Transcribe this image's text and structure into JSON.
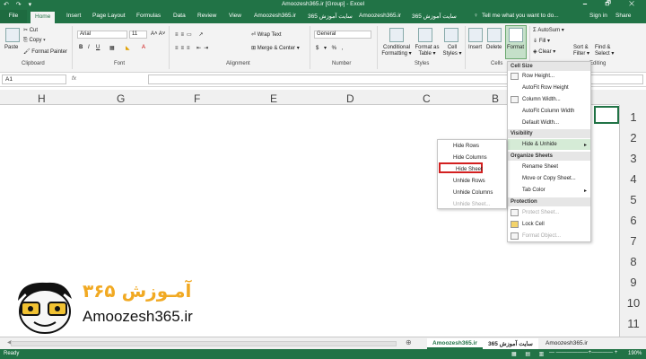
{
  "window": {
    "title": "Amoozesh365.ir  [Group]  - Excel",
    "qat": "↶ ↷ ▾",
    "controls": "🗕 🗗 ✕"
  },
  "tabs": {
    "file": "File",
    "home": "Home",
    "insert": "Insert",
    "page_layout": "Page Layout",
    "formulas": "Formulas",
    "data": "Data",
    "review": "Review",
    "view": "View",
    "extra1": "Amoozesh365.ir",
    "extra2": "سایت آموزش 365",
    "extra3": "Amoozesh365.ir",
    "extra4": "سایت آموزش 365",
    "tell_me": "Tell me what you want to do...",
    "signin": "Sign in",
    "share": "Share"
  },
  "ribbon": {
    "paste": "Paste",
    "cut": "Cut",
    "copy": "Copy ▾",
    "format_painter": "Format Painter",
    "clipboard": "Clipboard",
    "font_name": "Arial",
    "font_size": "11",
    "font_group": "Font",
    "wrap_text": "Wrap Text",
    "merge_center": "Merge & Center ▾",
    "alignment": "Alignment",
    "number_format": "General",
    "number_group": "Number",
    "number_symbols": "$ ▾ % ,",
    "cond_format": "Conditional Formatting ▾",
    "format_table": "Format as Table ▾",
    "cell_styles": "Cell Styles ▾",
    "styles": "Styles",
    "insert": "Insert",
    "delete": "Delete",
    "format": "Format",
    "cells": "Cells",
    "autosum": "AutoSum ▾",
    "fill": "Fill ▾",
    "clear": "Clear ▾",
    "sort_filter": "Sort & Filter ▾",
    "find_select": "Find & Select ▾",
    "editing": "Editing"
  },
  "formula_bar": {
    "name_box": "A1",
    "fx": "fx",
    "value": ""
  },
  "columns": [
    "H",
    "G",
    "F",
    "E",
    "D",
    "C",
    "B"
  ],
  "rows": [
    "1",
    "2",
    "3",
    "4",
    "5",
    "6",
    "7",
    "8",
    "9",
    "10",
    "11"
  ],
  "format_menu": {
    "cell_size": "Cell Size",
    "row_height": "Row Height...",
    "autofit_row": "AutoFit Row Height",
    "column_width": "Column Width...",
    "autofit_column": "AutoFit Column Width",
    "default_width": "Default Width...",
    "visibility": "Visibility",
    "hide_unhide": "Hide & Unhide",
    "organize": "Organize Sheets",
    "rename": "Rename Sheet",
    "move_copy": "Move or Copy Sheet...",
    "tab_color": "Tab Color",
    "protection": "Protection",
    "protect_sheet": "Protect Sheet...",
    "lock_cell": "Lock Cell",
    "format_object": "Format Object..."
  },
  "submenu": {
    "hide_rows": "Hide Rows",
    "hide_columns": "Hide Columns",
    "hide_sheet": "Hide Sheet",
    "unhide_rows": "Unhide Rows",
    "unhide_columns": "Unhide Columns",
    "unhide_sheet": "Unhide Sheet..."
  },
  "sheet_tabs": [
    "Amoozesh365.ir",
    "سایت آموزش 365",
    "Amoozesh365.ir"
  ],
  "status": {
    "ready": "Ready",
    "zoom": "190%"
  },
  "logo": {
    "text": "Amoozesh365.ir",
    "persian": "آمـوزش ۳۶۵"
  },
  "colors": {
    "excel_green": "#217346",
    "highlight_red": "#d32020"
  }
}
